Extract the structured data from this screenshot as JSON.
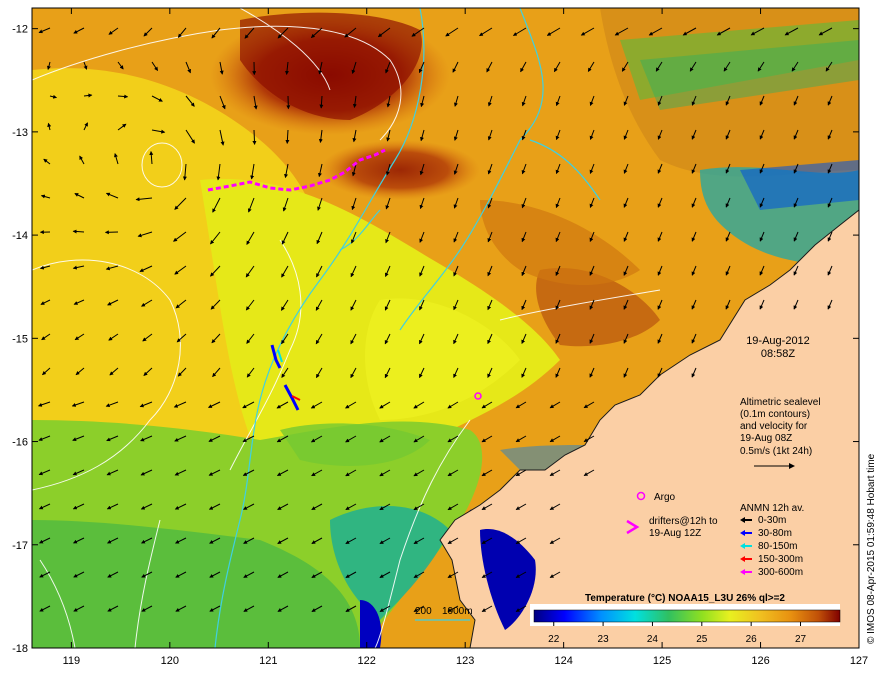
{
  "map": {
    "lon_ticks": [
      "119",
      "120",
      "121",
      "122",
      "123",
      "124",
      "125",
      "126",
      "127"
    ],
    "lat_ticks": [
      "-12",
      "-13",
      "-14",
      "-15",
      "-16",
      "-17",
      "-18"
    ],
    "lon_range": [
      118.6,
      127.0
    ],
    "lat_range": [
      -18.0,
      -11.8
    ],
    "ocean_color": "#e8a018",
    "land_color": "#fbcfa5"
  },
  "annotations": {
    "date": "19-Aug-2012",
    "time": "08:58Z",
    "altimetry": [
      "Altimetric sealevel",
      "(0.1m contours)",
      "and velocity for",
      "19-Aug 08Z",
      "0.5m/s (1kt 24h)"
    ],
    "argo": "Argo",
    "drifters": [
      "drifters@12h to",
      "19-Aug 12Z"
    ],
    "bathy": [
      "200",
      "1000m"
    ],
    "credit": "© IMOS 08-Apr-2015 01:59:48 Hobart time"
  },
  "legend": {
    "title": "ANMN 12h av.",
    "items": [
      {
        "label": "0-30m",
        "color": "#000000"
      },
      {
        "label": "30-80m",
        "color": "#0000ff"
      },
      {
        "label": "80-150m",
        "color": "#00e0e0"
      },
      {
        "label": "150-300m",
        "color": "#ff0000"
      },
      {
        "label": "300-600m",
        "color": "#ff00ff"
      }
    ]
  },
  "colorbar": {
    "title": "Temperature (°C) NOAA15_L3U 26% ql>=2",
    "ticks": [
      "22",
      "23",
      "24",
      "25",
      "26",
      "27"
    ],
    "range": [
      21.6,
      27.8
    ],
    "stops": [
      "#000080",
      "#0000ff",
      "#0090ff",
      "#00e0e0",
      "#30c060",
      "#90e020",
      "#e8f020",
      "#f0c020",
      "#e89010",
      "#c05008",
      "#800000"
    ]
  }
}
